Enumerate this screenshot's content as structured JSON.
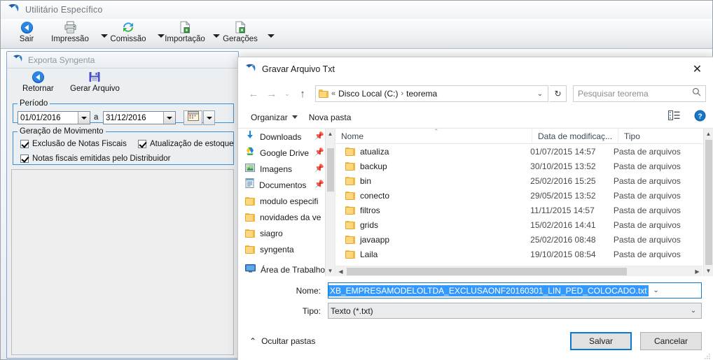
{
  "app": {
    "title": "Utilitário Específico",
    "toolbar": [
      {
        "label": "Sair",
        "accel": "S",
        "icon": "back-arrow-icon",
        "has_dropdown": false
      },
      {
        "label": "Impressão",
        "accel": "I",
        "icon": "printer-icon",
        "has_dropdown": true
      },
      {
        "label": "Comissão",
        "accel": "C",
        "icon": "refresh-sync-icon",
        "has_dropdown": true
      },
      {
        "label": "Importação",
        "accel": "I",
        "icon": "document-import-icon",
        "has_dropdown": true
      },
      {
        "label": "Gerações",
        "accel": "G",
        "icon": "document-export-icon",
        "has_dropdown": true
      }
    ]
  },
  "mdi": {
    "title": "Exporta Syngenta",
    "toolbar": [
      {
        "label": "Retornar",
        "accel": "R",
        "icon": "back-arrow-icon"
      },
      {
        "label": "Gerar Arquivo",
        "accel": "G",
        "icon": "save-floppy-icon"
      }
    ],
    "periodo": {
      "legend": "Período",
      "start_date": "01/01/2016",
      "separator": "a",
      "end_date": "31/12/2016",
      "calendar_icon": "calendar-icon"
    },
    "movimento": {
      "legend": "Geração de Movimento",
      "checkboxes": [
        {
          "label": "Exclusão de Notas Fiscais",
          "checked": true
        },
        {
          "label": "Atualização de estoque",
          "checked": true
        },
        {
          "label": "Notas fiscais emitidas pelo Distribuidor",
          "checked": true
        }
      ]
    }
  },
  "dialog": {
    "title": "Gravar Arquivo Txt",
    "close_glyph": "✕",
    "nav": {
      "back_glyph": "←",
      "forward_glyph": "→",
      "recent_glyph": "⌄",
      "up_glyph": "↑",
      "breadcrumb": {
        "prefix": "«",
        "items": [
          "Disco Local (C:)",
          "teorema"
        ],
        "separator": "›",
        "chevron": "⌄"
      },
      "refresh_glyph": "↻",
      "search_placeholder": "Pesquisar teorema",
      "search_icon": "search-icon"
    },
    "commandbar": {
      "organizar": "Organizar",
      "nova_pasta": "Nova pasta",
      "view_icon": "view-layout-icon",
      "help_icon": "help-icon"
    },
    "sidebar": [
      {
        "label": "Downloads",
        "icon": "download-icon",
        "pinned": true
      },
      {
        "label": "Google Drive",
        "icon": "google-drive-icon",
        "pinned": true
      },
      {
        "label": "Imagens",
        "icon": "pictures-icon",
        "pinned": true
      },
      {
        "label": "Documentos",
        "icon": "documents-icon",
        "pinned": true
      },
      {
        "label": "modulo especifi",
        "icon": "folder-icon",
        "pinned": false
      },
      {
        "label": "novidades da ve",
        "icon": "folder-icon",
        "pinned": false
      },
      {
        "label": "siagro",
        "icon": "folder-icon",
        "pinned": false
      },
      {
        "label": "syngenta",
        "icon": "folder-icon",
        "pinned": false
      },
      {
        "label": "Área de Trabalho",
        "icon": "desktop-icon",
        "pinned": false
      }
    ],
    "filelist": {
      "columns": [
        "Nome",
        "Data de modificaç...",
        "Tipo"
      ],
      "sort_indicator": "⌃",
      "rows": [
        {
          "name": "atualiza",
          "date": "01/07/2015 14:57",
          "type": "Pasta de arquivos"
        },
        {
          "name": "backup",
          "date": "30/10/2015 13:52",
          "type": "Pasta de arquivos"
        },
        {
          "name": "bin",
          "date": "25/02/2016 15:25",
          "type": "Pasta de arquivos"
        },
        {
          "name": "conecto",
          "date": "29/05/2015 13:52",
          "type": "Pasta de arquivos"
        },
        {
          "name": "filtros",
          "date": "11/11/2015 14:57",
          "type": "Pasta de arquivos"
        },
        {
          "name": "grids",
          "date": "15/02/2016 14:41",
          "type": "Pasta de arquivos"
        },
        {
          "name": "javaapp",
          "date": "25/02/2016 08:48",
          "type": "Pasta de arquivos"
        },
        {
          "name": "Laila",
          "date": "19/10/2015 08:54",
          "type": "Pasta de arquivos"
        }
      ]
    },
    "form": {
      "name_label": "Nome:",
      "name_value": "XB_EMPRESAMODELOLTDA_EXCLUSAONF20160301_LIN_PED_COLOCADO.txt",
      "type_label": "Tipo:",
      "type_value": "Texto (*.txt)",
      "chevron": "⌄"
    },
    "actions": {
      "hide_folders": "Ocultar pastas",
      "hide_folders_glyph": "⌃",
      "save": "Salvar",
      "cancel": "Cancelar"
    }
  },
  "colors": {
    "accent_blue": "#0b79d0",
    "selection_blue": "#3399ff",
    "group_border": "#3b8fd4"
  }
}
